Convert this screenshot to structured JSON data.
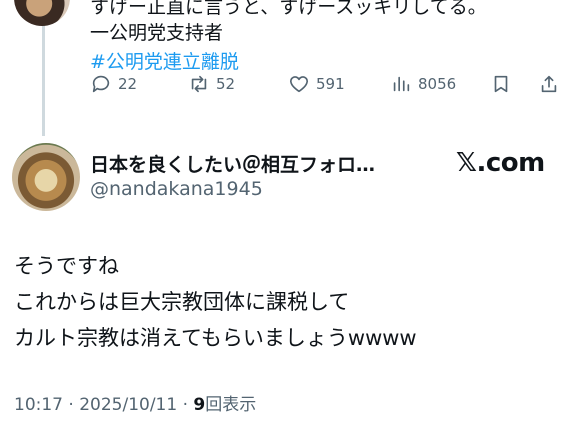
{
  "parent_tweet": {
    "cut_line": "すげー正直に言うと、すげースッキリしてる。",
    "signature": "一公明党支持者",
    "hashtag": "#公明党連立離脱",
    "stats": {
      "replies": "22",
      "retweets": "52",
      "likes": "591",
      "views": "8056"
    }
  },
  "reply_tweet": {
    "display_name": "日本を良くしたい＠相互フォロ…",
    "handle": "@nandakana1945",
    "site_label": "𝕏.com",
    "lines": [
      "そうですね",
      "これからは巨大宗教団体に課税して",
      "カルト宗教は消えてもらいましょうwwww"
    ],
    "timestamp": "10:17 · 2025/10/11 · ",
    "view_count": "9",
    "view_label": "回表示"
  }
}
